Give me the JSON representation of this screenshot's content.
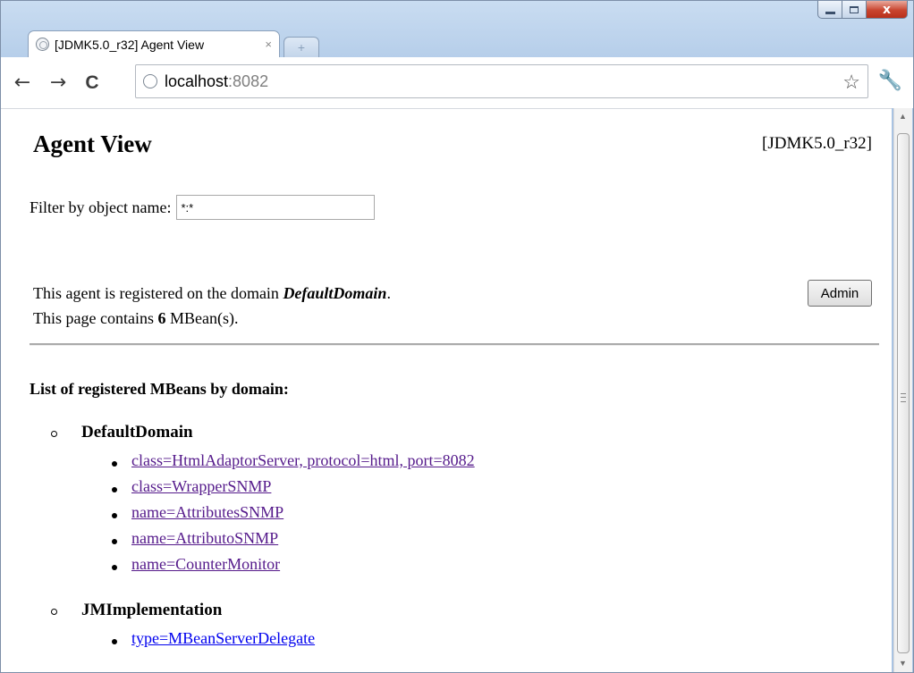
{
  "browser": {
    "tab_title": "[JDMK5.0_r32] Agent View",
    "tab_close": "×",
    "new_tab": "+",
    "url_host": "localhost",
    "url_port": ":8082",
    "back": "←",
    "forward": "→",
    "reload": "C",
    "star": "☆",
    "wrench": "🔧"
  },
  "window_controls": {
    "close": "x"
  },
  "page": {
    "title": "Agent View",
    "version": "[JDMK5.0_r32]",
    "filter_label": "Filter by object name:",
    "filter_value": "*:*",
    "info_line1_prefix": "This agent is registered on the domain ",
    "info_domain": "DefaultDomain",
    "info_line1_suffix": ".",
    "info_line2_prefix": "This page contains ",
    "info_count": "6",
    "info_line2_suffix": " MBean(s).",
    "admin_button": "Admin",
    "list_heading": "List of registered MBeans by domain:",
    "domains": [
      {
        "name": "DefaultDomain",
        "mbeans": [
          {
            "label": "class=HtmlAdaptorServer, protocol=html, port=8082",
            "visited": true
          },
          {
            "label": "class=WrapperSNMP",
            "visited": true
          },
          {
            "label": "name=AttributesSNMP",
            "visited": true
          },
          {
            "label": "name=AttributoSNMP",
            "visited": true
          },
          {
            "label": "name=CounterMonitor",
            "visited": true
          }
        ]
      },
      {
        "name": "JMImplementation",
        "mbeans": [
          {
            "label": "type=MBeanServerDelegate",
            "visited": false
          }
        ]
      }
    ]
  },
  "colors": {
    "visited_link": "#551a8b",
    "link": "#0000ee",
    "window_frame": "#b7cfea"
  }
}
